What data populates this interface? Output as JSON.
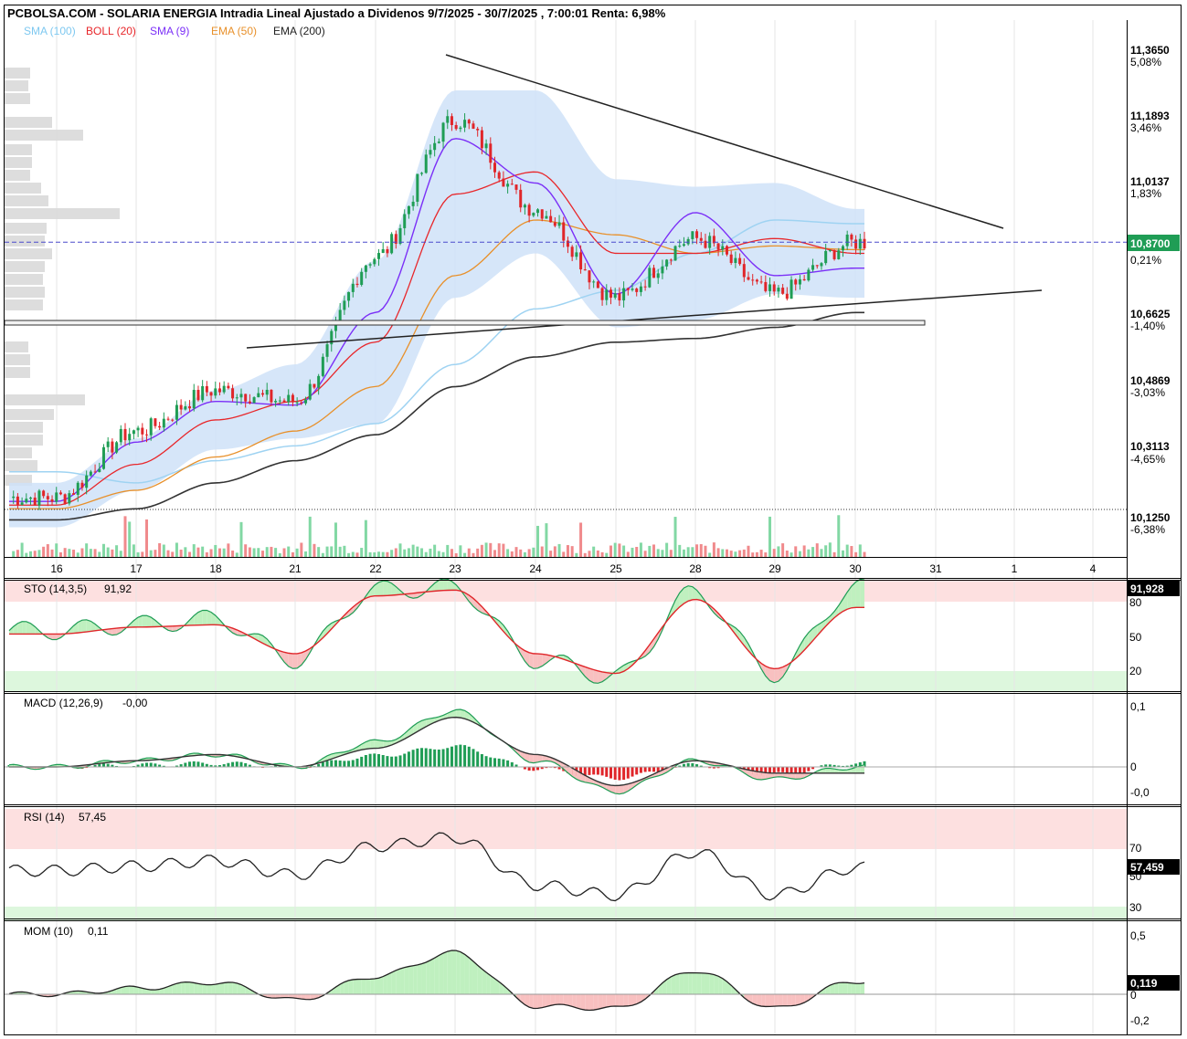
{
  "title": "PCBOLSA.COM - SOLARIA ENERGIA Intradia Lineal Ajustado a Dividenos 9/7/2025 - 30/7/2025 , 7:00:01 Renta: 6,98%",
  "legend": [
    {
      "label": "SMA (100)",
      "color": "#7ec8f0"
    },
    {
      "label": "BOLL (20)",
      "color": "#e8262a"
    },
    {
      "label": "SMA (9)",
      "color": "#7b2ff7"
    },
    {
      "label": "EMA (50)",
      "color": "#e8902a"
    },
    {
      "label": "EMA (200)",
      "color": "#222222"
    }
  ],
  "price_axis": [
    {
      "price": "11,3650",
      "pct": "5,08%",
      "pct_color": "#1a9a55"
    },
    {
      "price": "11,1893",
      "pct": "3,46%",
      "pct_color": "#1a9a55"
    },
    {
      "price": "11,0137",
      "pct": "1,83%",
      "pct_color": "#1a9a55"
    },
    {
      "price": "",
      "pct": "0,21%",
      "pct_color": "#1a9a55"
    },
    {
      "price": "10,6625",
      "pct": "-1,40%",
      "pct_color": "#e0262a"
    },
    {
      "price": "10,4869",
      "pct": "-3,03%",
      "pct_color": "#e0262a"
    },
    {
      "price": "10,3113",
      "pct": "-4,65%",
      "pct_color": "#e0262a"
    },
    {
      "price": "10,1250",
      "pct": "-6,38%",
      "pct_color": "#e0262a"
    }
  ],
  "last_price": "10,8700",
  "x_labels": [
    "16",
    "17",
    "18",
    "21",
    "22",
    "23",
    "24",
    "25",
    "28",
    "29",
    "30",
    "31",
    "1",
    "4"
  ],
  "colors": {
    "up": "#1f9d55",
    "down": "#e0262a",
    "band": "#cfe2f8",
    "last_price_bg": "#1f9d55",
    "readout_bg": "#000000"
  },
  "panels": {
    "sto": {
      "label": "STO (14,3,5)",
      "value": "91,92",
      "readout": "91,928",
      "levels": [
        "80",
        "50",
        "20"
      ]
    },
    "macd": {
      "label": "MACD (12,26,9)",
      "value": "-0,00",
      "levels": [
        "0,1",
        "0",
        "-0,0"
      ]
    },
    "rsi": {
      "label": "RSI (14)",
      "value": "57,45",
      "readout": "57,459",
      "levels": [
        "70",
        "50",
        "30"
      ]
    },
    "mom": {
      "label": "MOM (10)",
      "value": "0,11",
      "readout": "0,119",
      "levels": [
        "0,5",
        "0",
        "-0,2"
      ]
    }
  },
  "chart_data": {
    "type": "line",
    "subtype": "candlestick-with-indicators",
    "x": [
      "16",
      "17",
      "18",
      "21",
      "22",
      "23",
      "24",
      "25",
      "28",
      "29",
      "30"
    ],
    "series": [
      {
        "name": "Close",
        "values": [
          10.18,
          10.36,
          10.47,
          10.44,
          10.83,
          11.2,
          10.96,
          10.72,
          10.88,
          10.73,
          10.87
        ]
      },
      {
        "name": "SMA (9)",
        "values": [
          10.17,
          10.33,
          10.44,
          10.43,
          10.68,
          11.15,
          11.03,
          10.73,
          10.95,
          10.78,
          10.8
        ]
      },
      {
        "name": "BOLL (20)",
        "values": [
          10.16,
          10.27,
          10.39,
          10.44,
          10.6,
          11.0,
          11.06,
          10.84,
          10.84,
          10.88,
          10.84
        ]
      },
      {
        "name": "EMA (50)",
        "values": [
          10.15,
          10.2,
          10.29,
          10.36,
          10.48,
          10.78,
          10.93,
          10.89,
          10.84,
          10.86,
          10.85
        ]
      },
      {
        "name": "SMA (100)",
        "values": [
          10.25,
          10.22,
          10.28,
          10.32,
          10.38,
          10.54,
          10.69,
          10.74,
          10.84,
          10.93,
          10.92
        ]
      },
      {
        "name": "EMA (200)",
        "values": [
          10.12,
          10.15,
          10.22,
          10.28,
          10.35,
          10.48,
          10.56,
          10.6,
          10.61,
          10.64,
          10.68
        ]
      }
    ],
    "ylim": [
      10.02,
      11.47
    ],
    "ytick_labels": [
      "11,3650",
      "11,1893",
      "11,0137",
      "10,6625",
      "10,4869",
      "10,3113",
      "10,1250"
    ],
    "last": 10.87,
    "grid": true,
    "legend_position": "top-left"
  }
}
